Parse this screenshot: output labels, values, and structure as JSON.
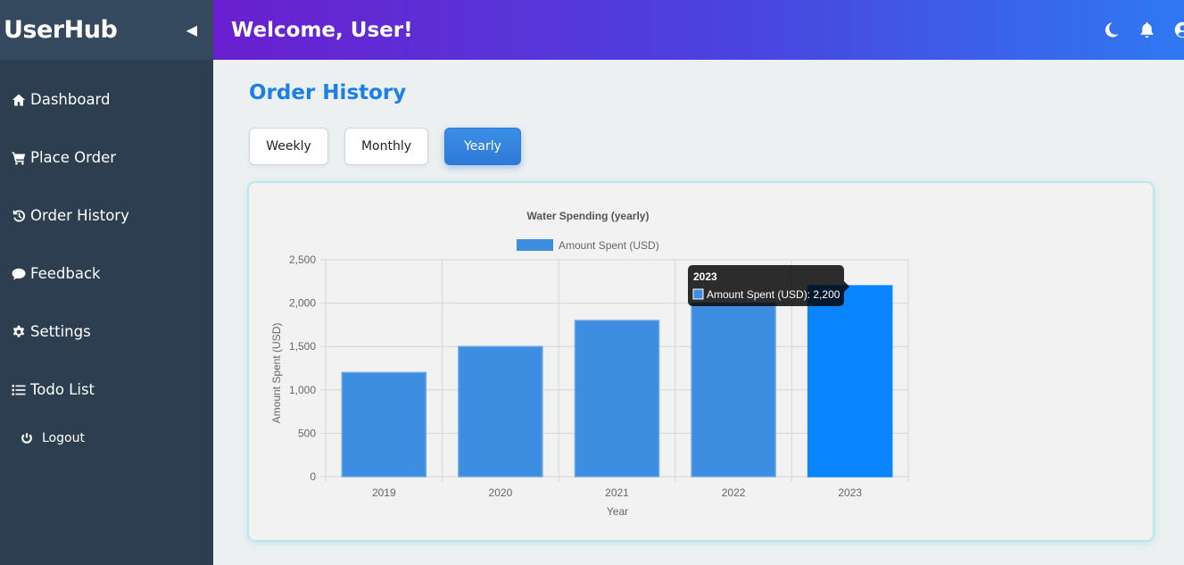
{
  "sidebar": {
    "brand": "UserHub",
    "collapse_icon": "caret-left-icon",
    "items": [
      {
        "label": "Dashboard",
        "icon": "home-icon"
      },
      {
        "label": "Place Order",
        "icon": "cart-icon"
      },
      {
        "label": "Order History",
        "icon": "history-icon"
      },
      {
        "label": "Feedback",
        "icon": "comment-icon"
      },
      {
        "label": "Settings",
        "icon": "gear-icon"
      },
      {
        "label": "Todo List",
        "icon": "list-icon"
      }
    ],
    "logout": "Logout"
  },
  "topbar": {
    "welcome": "Welcome, User!",
    "icons": [
      "moon-icon",
      "bell-icon",
      "user-circle-icon"
    ]
  },
  "main": {
    "title": "Order History",
    "tabs": [
      {
        "label": "Weekly",
        "active": false
      },
      {
        "label": "Monthly",
        "active": false
      },
      {
        "label": "Yearly",
        "active": true
      }
    ]
  },
  "colors": {
    "bar": "#3d8ee0",
    "bar_hover": "#0a84ff",
    "accent": "#1a7fe8"
  },
  "chart_data": {
    "type": "bar",
    "title": "Water Spending (yearly)",
    "xlabel": "Year",
    "ylabel": "Amount Spent (USD)",
    "categories": [
      "2019",
      "2020",
      "2021",
      "2022",
      "2023"
    ],
    "series": [
      {
        "name": "Amount Spent (USD)",
        "values": [
          1200,
          1500,
          1800,
          2000,
          2200
        ]
      }
    ],
    "ylim": [
      0,
      2500
    ],
    "yticks": [
      0,
      500,
      1000,
      1500,
      2000,
      2500
    ],
    "ytick_labels": [
      "0",
      "500",
      "1,000",
      "1,500",
      "2,000",
      "2,500"
    ],
    "grid": true,
    "legend": "top",
    "tooltip": {
      "title": "2023",
      "label": "Amount Spent (USD)",
      "value": "2,200"
    }
  }
}
